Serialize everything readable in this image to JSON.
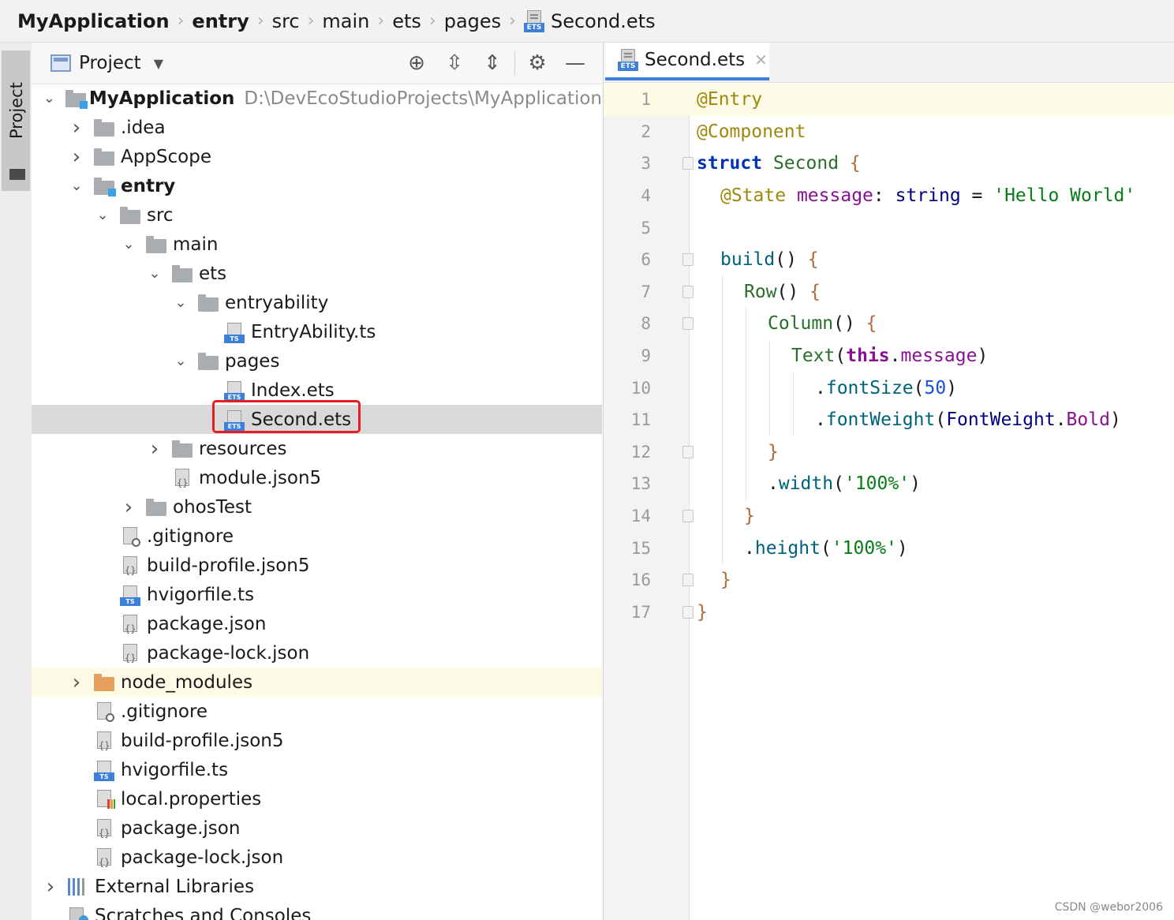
{
  "breadcrumb": [
    "MyApplication",
    "entry",
    "src",
    "main",
    "ets",
    "pages",
    "Second.ets"
  ],
  "toolstrip": {
    "project_label": "Project"
  },
  "panel": {
    "title": "Project",
    "tools": [
      "crosshair-icon",
      "expand-all-icon",
      "collapse-all-icon",
      "gear-icon",
      "minimize-icon"
    ]
  },
  "tree": [
    {
      "name": "MyApplication",
      "path": "D:\\DevEcoStudioProjects\\MyApplication",
      "depth": 0,
      "arrow": "down",
      "icon": "module-folder",
      "bold": true
    },
    {
      "name": ".idea",
      "depth": 1,
      "arrow": "right",
      "icon": "folder"
    },
    {
      "name": "AppScope",
      "depth": 1,
      "arrow": "right",
      "icon": "folder"
    },
    {
      "name": "entry",
      "depth": 1,
      "arrow": "down",
      "icon": "module-folder",
      "bold": true
    },
    {
      "name": "src",
      "depth": 2,
      "arrow": "down",
      "icon": "folder"
    },
    {
      "name": "main",
      "depth": 3,
      "arrow": "down",
      "icon": "folder"
    },
    {
      "name": "ets",
      "depth": 4,
      "arrow": "down",
      "icon": "folder"
    },
    {
      "name": "entryability",
      "depth": 5,
      "arrow": "down",
      "icon": "folder"
    },
    {
      "name": "EntryAbility.ts",
      "depth": 6,
      "arrow": "none",
      "icon": "ts"
    },
    {
      "name": "pages",
      "depth": 5,
      "arrow": "down",
      "icon": "folder"
    },
    {
      "name": "Index.ets",
      "depth": 6,
      "arrow": "none",
      "icon": "ets"
    },
    {
      "name": "Second.ets",
      "depth": 6,
      "arrow": "none",
      "icon": "ets",
      "selected": true
    },
    {
      "name": "resources",
      "depth": 4,
      "arrow": "right",
      "icon": "folder"
    },
    {
      "name": "module.json5",
      "depth": 4,
      "arrow": "none",
      "icon": "json"
    },
    {
      "name": "ohosTest",
      "depth": 3,
      "arrow": "right",
      "icon": "folder"
    },
    {
      "name": ".gitignore",
      "depth": 2,
      "arrow": "none",
      "icon": "git"
    },
    {
      "name": "build-profile.json5",
      "depth": 2,
      "arrow": "none",
      "icon": "json"
    },
    {
      "name": "hvigorfile.ts",
      "depth": 2,
      "arrow": "none",
      "icon": "ts"
    },
    {
      "name": "package.json",
      "depth": 2,
      "arrow": "none",
      "icon": "json"
    },
    {
      "name": "package-lock.json",
      "depth": 2,
      "arrow": "none",
      "icon": "json"
    },
    {
      "name": "node_modules",
      "depth": 1,
      "arrow": "right",
      "icon": "orange-folder",
      "excluded": true
    },
    {
      "name": ".gitignore",
      "depth": 1,
      "arrow": "none",
      "icon": "git"
    },
    {
      "name": "build-profile.json5",
      "depth": 1,
      "arrow": "none",
      "icon": "json"
    },
    {
      "name": "hvigorfile.ts",
      "depth": 1,
      "arrow": "none",
      "icon": "ts"
    },
    {
      "name": "local.properties",
      "depth": 1,
      "arrow": "none",
      "icon": "properties"
    },
    {
      "name": "package.json",
      "depth": 1,
      "arrow": "none",
      "icon": "json"
    },
    {
      "name": "package-lock.json",
      "depth": 1,
      "arrow": "none",
      "icon": "json"
    },
    {
      "name": "External Libraries",
      "depth": 0,
      "arrow": "right",
      "icon": "libraries"
    },
    {
      "name": "Scratches and Consoles",
      "depth": 0,
      "arrow": "none",
      "icon": "scratches"
    }
  ],
  "editor": {
    "tab_label": "Second.ets",
    "current_line": 1,
    "lines": [
      {
        "n": "1",
        "indent": 0,
        "fold": "none",
        "tokens": [
          [
            "ann",
            "@Entry"
          ]
        ]
      },
      {
        "n": "2",
        "indent": 0,
        "fold": "none",
        "tokens": [
          [
            "ann",
            "@Component"
          ]
        ]
      },
      {
        "n": "3",
        "indent": 0,
        "fold": "open",
        "tokens": [
          [
            "kw",
            "struct"
          ],
          [
            "plain",
            " "
          ],
          [
            "cls",
            "Second"
          ],
          [
            "plain",
            " "
          ],
          [
            "brace",
            "{"
          ]
        ]
      },
      {
        "n": "4",
        "indent": 1,
        "fold": "none",
        "tokens": [
          [
            "ann",
            "@State"
          ],
          [
            "plain",
            " "
          ],
          [
            "prop",
            "message"
          ],
          [
            "plain",
            ": "
          ],
          [
            "type",
            "string"
          ],
          [
            "plain",
            " = "
          ],
          [
            "str",
            "'Hello World'"
          ]
        ]
      },
      {
        "n": "5",
        "indent": 0,
        "fold": "none",
        "tokens": []
      },
      {
        "n": "6",
        "indent": 1,
        "fold": "open",
        "tokens": [
          [
            "fn",
            "build"
          ],
          [
            "plain",
            "() "
          ],
          [
            "brace",
            "{"
          ]
        ]
      },
      {
        "n": "7",
        "indent": 2,
        "fold": "open",
        "tokens": [
          [
            "cls",
            "Row"
          ],
          [
            "plain",
            "() "
          ],
          [
            "brace",
            "{"
          ]
        ]
      },
      {
        "n": "8",
        "indent": 3,
        "fold": "open",
        "tokens": [
          [
            "cls",
            "Column"
          ],
          [
            "plain",
            "() "
          ],
          [
            "brace",
            "{"
          ]
        ]
      },
      {
        "n": "9",
        "indent": 4,
        "fold": "none",
        "tokens": [
          [
            "cls",
            "Text"
          ],
          [
            "plain",
            "("
          ],
          [
            "kw2",
            "this"
          ],
          [
            "plain",
            "."
          ],
          [
            "prop",
            "message"
          ],
          [
            "plain",
            ")"
          ]
        ]
      },
      {
        "n": "10",
        "indent": 5,
        "fold": "none",
        "tokens": [
          [
            "plain",
            "."
          ],
          [
            "method",
            "fontSize"
          ],
          [
            "plain",
            "("
          ],
          [
            "num",
            "50"
          ],
          [
            "plain",
            ")"
          ]
        ]
      },
      {
        "n": "11",
        "indent": 5,
        "fold": "none",
        "tokens": [
          [
            "plain",
            "."
          ],
          [
            "method",
            "fontWeight"
          ],
          [
            "plain",
            "("
          ],
          [
            "type",
            "FontWeight"
          ],
          [
            "plain",
            "."
          ],
          [
            "prop",
            "Bold"
          ],
          [
            "plain",
            ")"
          ]
        ]
      },
      {
        "n": "12",
        "indent": 3,
        "fold": "close",
        "tokens": [
          [
            "brace",
            "}"
          ]
        ]
      },
      {
        "n": "13",
        "indent": 3,
        "fold": "none",
        "tokens": [
          [
            "plain",
            "."
          ],
          [
            "method",
            "width"
          ],
          [
            "plain",
            "("
          ],
          [
            "str",
            "'100%'"
          ],
          [
            "plain",
            ")"
          ]
        ]
      },
      {
        "n": "14",
        "indent": 2,
        "fold": "close",
        "tokens": [
          [
            "brace",
            "}"
          ]
        ]
      },
      {
        "n": "15",
        "indent": 2,
        "fold": "none",
        "tokens": [
          [
            "plain",
            "."
          ],
          [
            "method",
            "height"
          ],
          [
            "plain",
            "("
          ],
          [
            "str",
            "'100%'"
          ],
          [
            "plain",
            ")"
          ]
        ]
      },
      {
        "n": "16",
        "indent": 1,
        "fold": "close",
        "tokens": [
          [
            "brace",
            "}"
          ]
        ]
      },
      {
        "n": "17",
        "indent": 0,
        "fold": "close",
        "tokens": [
          [
            "brace",
            "}"
          ]
        ]
      }
    ]
  },
  "watermark": "CSDN @webor2006",
  "colors": {
    "accent": "#3d7fd9",
    "highlight_box": "#e31e24",
    "selected_row": "#d9d9d9"
  }
}
